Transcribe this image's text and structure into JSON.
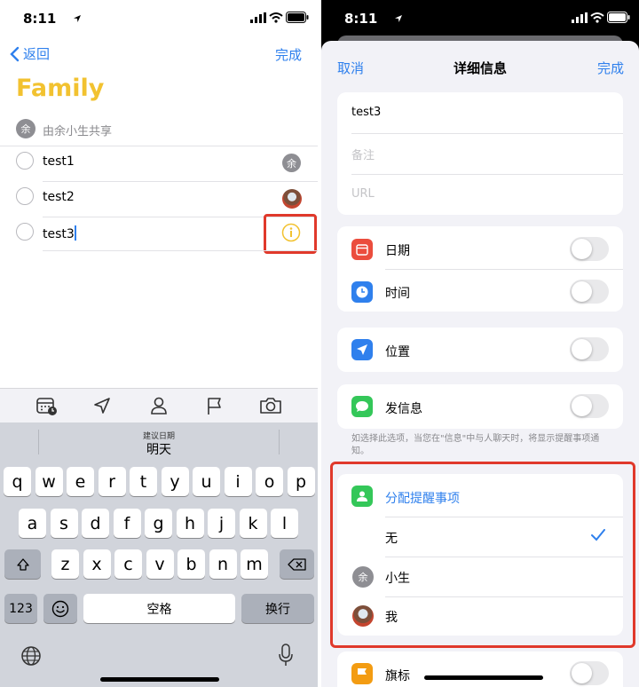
{
  "left": {
    "status": {
      "time": "8:11"
    },
    "nav": {
      "back": "返回",
      "done": "完成"
    },
    "list_title": "Family",
    "shared_avatar": "余",
    "shared_by": "由余小生共享",
    "tasks": [
      {
        "title": "test1",
        "avatar": "余"
      },
      {
        "title": "test2"
      },
      {
        "title": "test3"
      }
    ],
    "suggestion": {
      "caption": "建议日期",
      "value": "明天"
    },
    "keyboard": {
      "row1": [
        "q",
        "w",
        "e",
        "r",
        "t",
        "y",
        "u",
        "i",
        "o",
        "p"
      ],
      "row2": [
        "a",
        "s",
        "d",
        "f",
        "g",
        "h",
        "j",
        "k",
        "l"
      ],
      "row3": [
        "z",
        "x",
        "c",
        "v",
        "b",
        "n",
        "m"
      ],
      "numbers": "123",
      "space": "空格",
      "return": "换行"
    },
    "colors": {
      "accent": "#2f80ed",
      "list": "#f2c230",
      "highlight": "#e0392b"
    }
  },
  "right": {
    "status": {
      "time": "8:11"
    },
    "header": {
      "cancel": "取消",
      "title": "详细信息",
      "done": "完成"
    },
    "fields": {
      "title": "test3",
      "notes_placeholder": "备注",
      "url_placeholder": "URL"
    },
    "rows": {
      "date": "日期",
      "time": "时间",
      "location": "位置",
      "message": "发信息",
      "flag": "旗标"
    },
    "message_footnote": "如选择此选项，当您在\"信息\"中与人聊天时，将显示提醒事项通知。",
    "assign": {
      "title": "分配提醒事项",
      "options": [
        {
          "label": "无",
          "selected": true
        },
        {
          "label": "小生",
          "avatar": "余"
        },
        {
          "label": "我"
        }
      ]
    },
    "toggles": {
      "date": false,
      "time": false,
      "location": false,
      "message": false,
      "flag": false
    }
  }
}
